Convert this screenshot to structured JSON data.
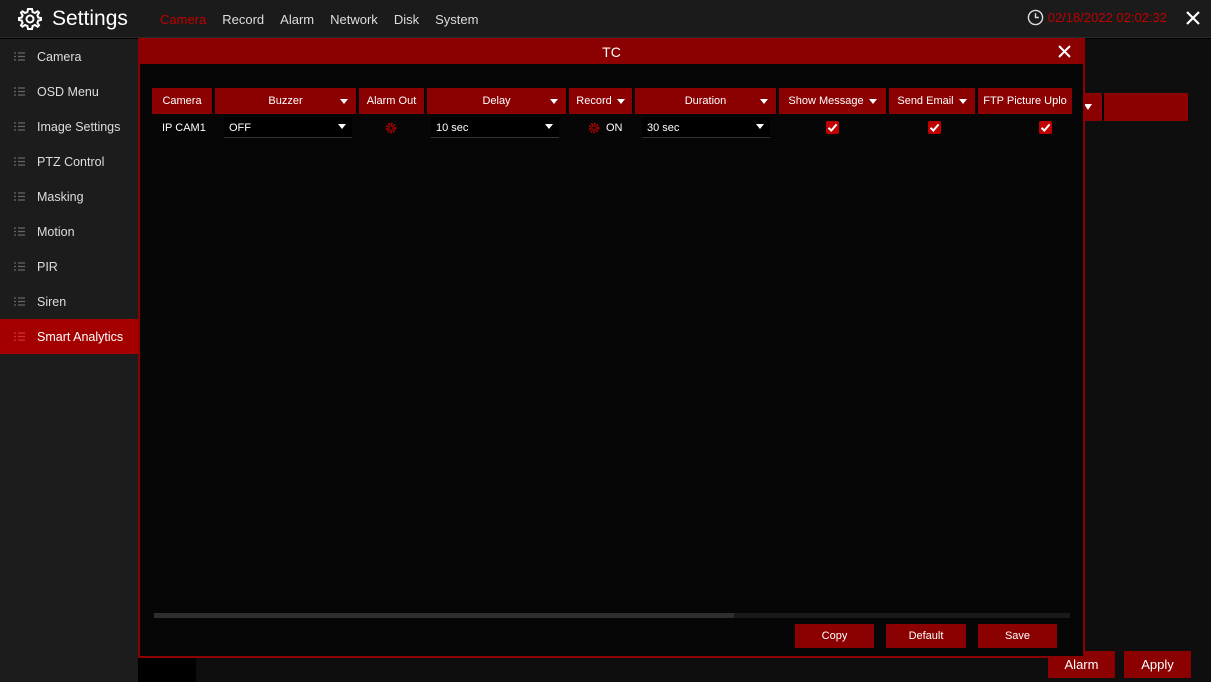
{
  "app": {
    "title": "Settings",
    "icon": "gear-icon"
  },
  "top_tabs": [
    {
      "label": "Camera",
      "active": true
    },
    {
      "label": "Record"
    },
    {
      "label": "Alarm"
    },
    {
      "label": "Network"
    },
    {
      "label": "Disk"
    },
    {
      "label": "System"
    }
  ],
  "clock": {
    "datetime": "02/18/2022 02:02:32"
  },
  "sidebar": {
    "items": [
      {
        "label": "Camera"
      },
      {
        "label": "OSD Menu"
      },
      {
        "label": "Image Settings"
      },
      {
        "label": "PTZ Control"
      },
      {
        "label": "Masking"
      },
      {
        "label": "Motion"
      },
      {
        "label": "PIR"
      },
      {
        "label": "Siren"
      },
      {
        "label": "Smart Analytics",
        "active": true
      }
    ]
  },
  "modal": {
    "title": "TC",
    "columns": {
      "camera": "Camera",
      "buzzer": "Buzzer",
      "alarm_out": "Alarm Out",
      "delay": "Delay",
      "record": "Record",
      "duration": "Duration",
      "show_message": "Show Message",
      "send_email": "Send Email",
      "ftp_upload": "FTP Picture Uplo"
    },
    "row": {
      "camera": "IP CAM1",
      "buzzer": "OFF",
      "delay": "10 sec",
      "record": "ON",
      "duration": "30 sec",
      "show_message": true,
      "send_email": true,
      "ftp_upload": true
    },
    "buttons": {
      "copy": "Copy",
      "default": "Default",
      "save": "Save"
    }
  },
  "bottom_buttons": {
    "alarm": "Alarm",
    "apply": "Apply"
  },
  "colors": {
    "accent": "#8b0000",
    "active_text": "#c00000",
    "background": "#000000"
  }
}
